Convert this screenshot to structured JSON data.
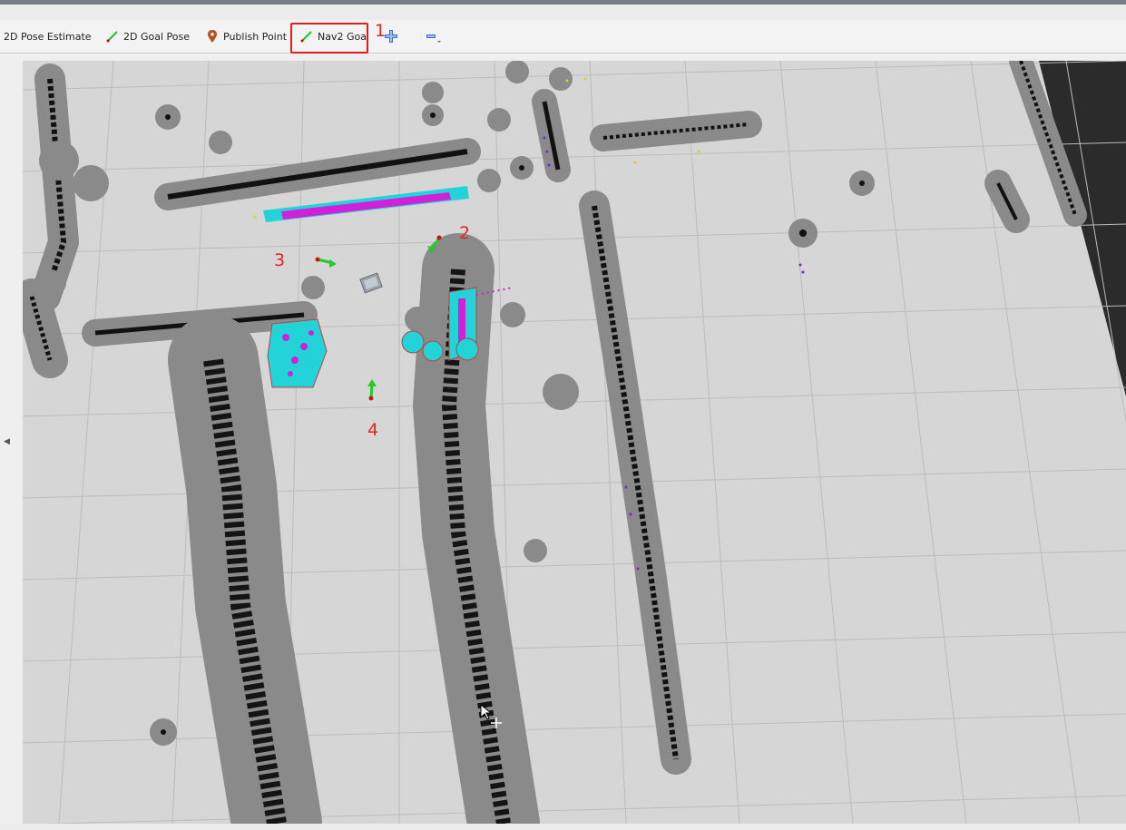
{
  "toolbar": {
    "pose_estimate_label": "2D Pose Estimate",
    "goal_pose_label": "2D Goal Pose",
    "publish_point_label": "Publish Point",
    "nav2_goal_label": "Nav2 Goal",
    "icons": {
      "pose_estimate": "green-arrow-icon",
      "goal_pose": "green-arrow-icon",
      "publish_point": "map-pin-icon",
      "nav2_goal": "green-arrow-icon",
      "add_tool": "plus-icon",
      "remove_tool": "minus-icon"
    }
  },
  "annotations": [
    "1",
    "2",
    "3",
    "4"
  ],
  "colors": {
    "map_free": "#d6d6d6",
    "inflation": "#8c8c8c",
    "obstacle": "#111111",
    "costmap_cyan": "#22d3d8",
    "costmap_magenta": "#d020d8",
    "goal_arrow": "#22cc22",
    "annotation_red": "#e8231a",
    "unknown_space": "#2b2b2b"
  }
}
